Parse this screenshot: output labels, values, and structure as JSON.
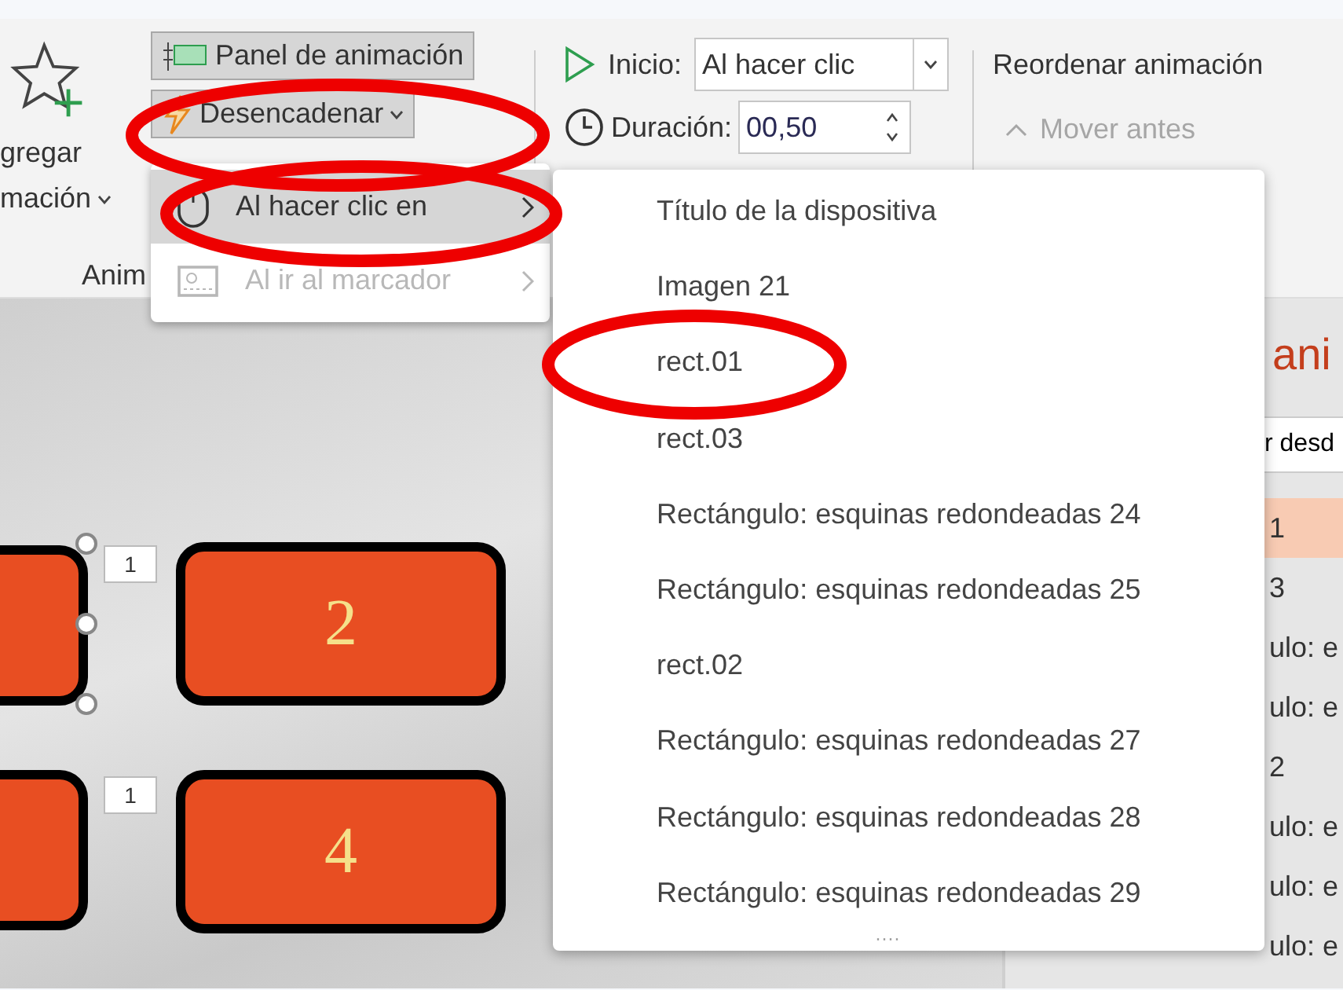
{
  "ribbon": {
    "add_animation": {
      "line1": "gregar",
      "line2": "mación"
    },
    "group_label": "Anim",
    "animation_pane_button": "Panel de animación",
    "trigger_button": "Desencadenar",
    "start": {
      "label": "Inicio:",
      "value": "Al hacer clic"
    },
    "duration": {
      "label": "Duración:",
      "value": "00,50"
    },
    "reorder": {
      "title": "Reordenar animación",
      "move_earlier": {
        "label": "Mover antes",
        "disabled": true
      }
    }
  },
  "trigger_menu": [
    {
      "label": "Al hacer clic en",
      "selected": true,
      "disabled": false
    },
    {
      "label": "Al ir al marcador",
      "selected": false,
      "disabled": true
    }
  ],
  "submenu": {
    "items": [
      "Título de la dispositiva",
      "Imagen 21",
      "rect.01",
      "rect.03",
      "Rectángulo: esquinas redondeadas 24",
      "Rectángulo: esquinas redondeadas 25",
      "rect.02",
      "Rectángulo: esquinas redondeadas 27",
      "Rectángulo: esquinas redondeadas 28",
      "Rectángulo: esquinas redondeadas 29"
    ],
    "more": "····"
  },
  "slide": {
    "shapes": [
      {
        "badge": "1",
        "selected": true
      },
      {
        "number": "2",
        "selected": false
      },
      {
        "badge": "1",
        "selected": false
      },
      {
        "number": "4",
        "selected": false
      }
    ]
  },
  "animation_pane": {
    "title": "ani",
    "play_button": "r desd",
    "items": [
      {
        "label": "1",
        "selected": true
      },
      {
        "label": "3",
        "selected": false
      },
      {
        "label": "ulo: e",
        "selected": false
      },
      {
        "label": "ulo: e",
        "selected": false
      },
      {
        "label": "2",
        "selected": false
      },
      {
        "label": "ulo: e",
        "selected": false
      },
      {
        "label": "ulo: e",
        "selected": false
      },
      {
        "label": "ulo: e",
        "selected": false
      }
    ]
  }
}
